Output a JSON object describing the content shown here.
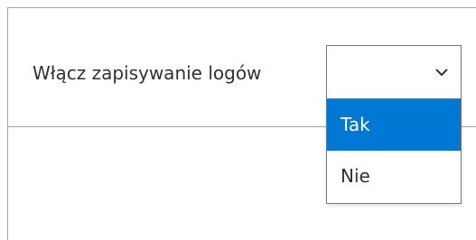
{
  "setting": {
    "label": "Włącz zapisywanie logów",
    "current_value": ""
  },
  "dropdown": {
    "chevron_icon": "chevron-down-icon",
    "options": [
      {
        "label": "Tak",
        "highlighted": true
      },
      {
        "label": "Nie",
        "highlighted": false
      }
    ]
  },
  "colors": {
    "highlight": "#0078d4",
    "border": "#767676",
    "divider": "#a6a6a6",
    "text": "#323130"
  }
}
